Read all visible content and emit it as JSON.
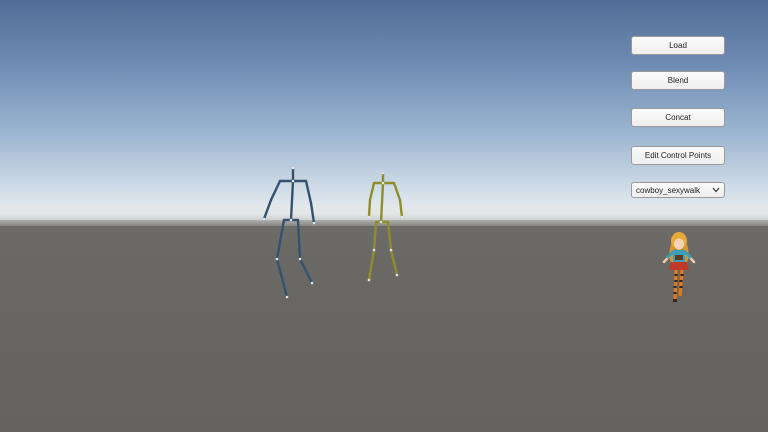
{
  "toolbar": {
    "load_label": "Load",
    "blend_label": "Blend",
    "concat_label": "Concat",
    "edit_control_points_label": "Edit Control Points"
  },
  "animation_select": {
    "selected": "cowboy_sexywalk",
    "chevron_icon": "chevron-down-icon"
  },
  "scene": {
    "skeleton_a_color": "#2f4f6b",
    "skeleton_b_color": "#8f8f2a",
    "joint_color": "#d8dde2",
    "character": "anime-girl-character"
  }
}
